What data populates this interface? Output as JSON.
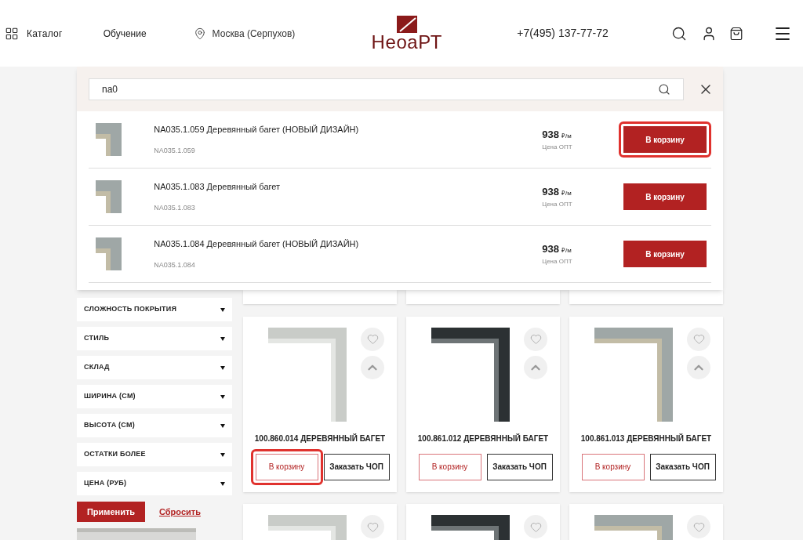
{
  "header": {
    "catalog": "Каталог",
    "training": "Обучение",
    "city": "Москва (Серпухов)",
    "logo": "НеоаРТ",
    "phone": "+7(495) 137-77-72"
  },
  "search": {
    "value": "na0",
    "results": [
      {
        "title": "NA035.1.059 Деревянный багет (НОВЫЙ ДИЗАЙН)",
        "sku": "NA035.1.059",
        "price": "938",
        "unit": "₽/м",
        "price_note": "Цена ОПТ",
        "button": "В корзину",
        "highlighted": true
      },
      {
        "title": "NA035.1.083 Деревянный багет",
        "sku": "NA035.1.083",
        "price": "938",
        "unit": "₽/м",
        "price_note": "Цена ОПТ",
        "button": "В корзину",
        "highlighted": false
      },
      {
        "title": "NA035.1.084 Деревянный багет (НОВЫЙ ДИЗАЙН)",
        "sku": "NA035.1.084",
        "price": "938",
        "unit": "₽/м",
        "price_note": "Цена ОПТ",
        "button": "В корзину",
        "highlighted": false
      }
    ]
  },
  "filters": {
    "items": [
      {
        "label": "СЛОЖНОСТЬ ПОКРЫТИЯ",
        "expanded": false
      },
      {
        "label": "СТИЛЬ",
        "expanded": false
      },
      {
        "label": "СКЛАД",
        "expanded": false
      },
      {
        "label": "ШИРИНА (СМ)",
        "expanded": false
      },
      {
        "label": "ВЫСОТА (СМ)",
        "expanded": false
      },
      {
        "label": "ОСТАТКИ БОЛЕЕ",
        "expanded": false
      },
      {
        "label": "ЦЕНА (РУБ)",
        "expanded": false
      }
    ],
    "apply": "Применить",
    "reset": "Сбросить"
  },
  "products": [
    {
      "title": "100.860.014 ДЕРЕВЯННЫЙ БАГЕТ",
      "cart_button": "В корзину",
      "order_button": "Заказать ЧОП",
      "highlighted": true
    },
    {
      "title": "100.861.012 ДЕРЕВЯННЫЙ БАГЕТ",
      "cart_button": "В корзину",
      "order_button": "Заказать ЧОП",
      "highlighted": false
    },
    {
      "title": "100.861.013 ДЕРЕВЯННЫЙ БАГЕТ",
      "cart_button": "В корзину",
      "order_button": "Заказать ЧОП",
      "highlighted": false
    }
  ]
}
